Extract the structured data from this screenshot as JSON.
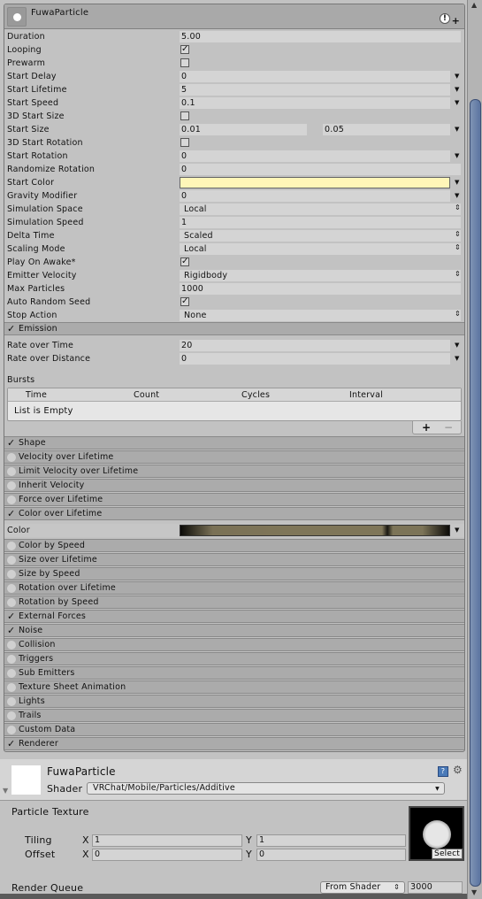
{
  "component": {
    "title": "FuwaParticle",
    "icons": [
      "particle-system-icon",
      "warning-icon",
      "add-icon"
    ]
  },
  "main_rows": [
    {
      "label": "Duration",
      "type": "float",
      "value": "5.00"
    },
    {
      "label": "Looping",
      "type": "check",
      "checked": true
    },
    {
      "label": "Prewarm",
      "type": "check",
      "checked": false
    },
    {
      "label": "Start Delay",
      "type": "curve",
      "value": "0"
    },
    {
      "label": "Start Lifetime",
      "type": "curve",
      "value": "5"
    },
    {
      "label": "Start Speed",
      "type": "curve",
      "value": "0.1"
    },
    {
      "label": "3D Start Size",
      "type": "check",
      "checked": false
    },
    {
      "label": "Start Size",
      "type": "dual",
      "value": "0.01",
      "value2": "0.05"
    },
    {
      "label": "3D Start Rotation",
      "type": "check",
      "checked": false
    },
    {
      "label": "Start Rotation",
      "type": "curve",
      "value": "0"
    },
    {
      "label": "Randomize Rotation",
      "type": "float",
      "value": "0"
    },
    {
      "label": "Start Color",
      "type": "color",
      "color": "#fff6b8"
    },
    {
      "label": "Gravity Modifier",
      "type": "curve",
      "value": "0"
    },
    {
      "label": "Simulation Space",
      "type": "enum",
      "value": "Local"
    },
    {
      "label": "Simulation Speed",
      "type": "float",
      "value": "1"
    },
    {
      "label": "Delta Time",
      "type": "enum",
      "value": "Scaled"
    },
    {
      "label": "Scaling Mode",
      "type": "enum",
      "value": "Local"
    },
    {
      "label": "Play On Awake*",
      "type": "check",
      "checked": true
    },
    {
      "label": "Emitter Velocity",
      "type": "enum",
      "value": "Rigidbody"
    },
    {
      "label": "Max Particles",
      "type": "float",
      "value": "1000"
    },
    {
      "label": "Auto Random Seed",
      "type": "check",
      "checked": true
    },
    {
      "label": "Stop Action",
      "type": "enum",
      "value": "None"
    }
  ],
  "emission": {
    "label": "Emission",
    "enabled": true,
    "rows": [
      {
        "label": "Rate over Time",
        "type": "curve",
        "value": "20"
      },
      {
        "label": "Rate over Distance",
        "type": "curve",
        "value": "0"
      }
    ],
    "bursts_label": "Bursts",
    "bursts_columns": [
      "Time",
      "Count",
      "Cycles",
      "Interval"
    ],
    "bursts_empty": "List is Empty",
    "add_label": "+",
    "remove_label": "−"
  },
  "modules_a": [
    {
      "label": "Shape",
      "enabled": true
    },
    {
      "label": "Velocity over Lifetime",
      "enabled": false
    },
    {
      "label": "Limit Velocity over Lifetime",
      "enabled": false
    },
    {
      "label": "Inherit Velocity",
      "enabled": false
    },
    {
      "label": "Force over Lifetime",
      "enabled": false
    },
    {
      "label": "Color over Lifetime",
      "enabled": true
    }
  ],
  "color_row": {
    "label": "Color",
    "gradient": [
      "#0c0b08",
      "#7a7156",
      "#7f7659",
      "#1a1812",
      "#7c7458",
      "#0c0b08"
    ]
  },
  "modules_b": [
    {
      "label": "Color by Speed",
      "enabled": false
    },
    {
      "label": "Size over Lifetime",
      "enabled": false
    },
    {
      "label": "Size by Speed",
      "enabled": false
    },
    {
      "label": "Rotation over Lifetime",
      "enabled": false
    },
    {
      "label": "Rotation by Speed",
      "enabled": false
    },
    {
      "label": "External Forces",
      "enabled": true
    },
    {
      "label": "Noise",
      "enabled": true
    },
    {
      "label": "Collision",
      "enabled": false
    },
    {
      "label": "Triggers",
      "enabled": false
    },
    {
      "label": "Sub Emitters",
      "enabled": false
    },
    {
      "label": "Texture Sheet Animation",
      "enabled": false
    },
    {
      "label": "Lights",
      "enabled": false
    },
    {
      "label": "Trails",
      "enabled": false
    },
    {
      "label": "Custom Data",
      "enabled": false
    },
    {
      "label": "Renderer",
      "enabled": true
    }
  ],
  "material": {
    "name": "FuwaParticle",
    "shader_label": "Shader",
    "shader_value": "VRChat/Mobile/Particles/Additive",
    "texture_label": "Particle Texture",
    "tiling_label": "Tiling",
    "offset_label": "Offset",
    "x_label": "X",
    "y_label": "Y",
    "tiling_x": "1",
    "tiling_y": "1",
    "offset_x": "0",
    "offset_y": "0",
    "select_label": "Select",
    "render_queue_label": "Render Queue",
    "render_queue_mode": "From Shader",
    "render_queue_value": "3000"
  }
}
